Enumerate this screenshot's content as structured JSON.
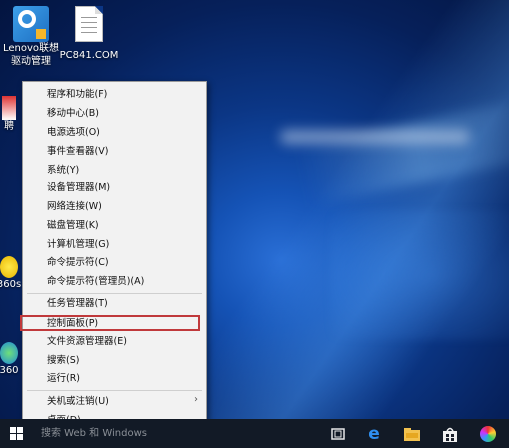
{
  "desktop": {
    "icons": [
      {
        "label_line1": "Lenovo联想",
        "label_line2": "驱动管理",
        "icon": "lenovo-driver-icon"
      },
      {
        "label_line1": "PC841.COM",
        "icon": "document-icon"
      }
    ],
    "partial_labels": [
      "聘",
      "360s",
      "360"
    ]
  },
  "context_menu": {
    "items": [
      {
        "label": "程序和功能(F)"
      },
      {
        "label": "移动中心(B)"
      },
      {
        "label": "电源选项(O)"
      },
      {
        "label": "事件查看器(V)"
      },
      {
        "label": "系统(Y)"
      },
      {
        "label": "设备管理器(M)"
      },
      {
        "label": "网络连接(W)"
      },
      {
        "label": "磁盘管理(K)"
      },
      {
        "label": "计算机管理(G)"
      },
      {
        "label": "命令提示符(C)"
      },
      {
        "label": "命令提示符(管理员)(A)"
      },
      {
        "label": "任务管理器(T)"
      },
      {
        "label": "控制面板(P)",
        "highlighted": true
      },
      {
        "label": "文件资源管理器(E)"
      },
      {
        "label": "搜索(S)"
      },
      {
        "label": "运行(R)"
      },
      {
        "label": "关机或注销(U)",
        "submenu": true
      },
      {
        "label": "桌面(D)"
      }
    ],
    "highlight_color": "#c0393b"
  },
  "taskbar": {
    "search_placeholder": "搜索 Web 和 Windows",
    "icons": [
      "start-icon",
      "task-view-icon",
      "edge-icon",
      "file-explorer-icon",
      "store-icon",
      "app-icon"
    ],
    "background": "#121a26"
  }
}
